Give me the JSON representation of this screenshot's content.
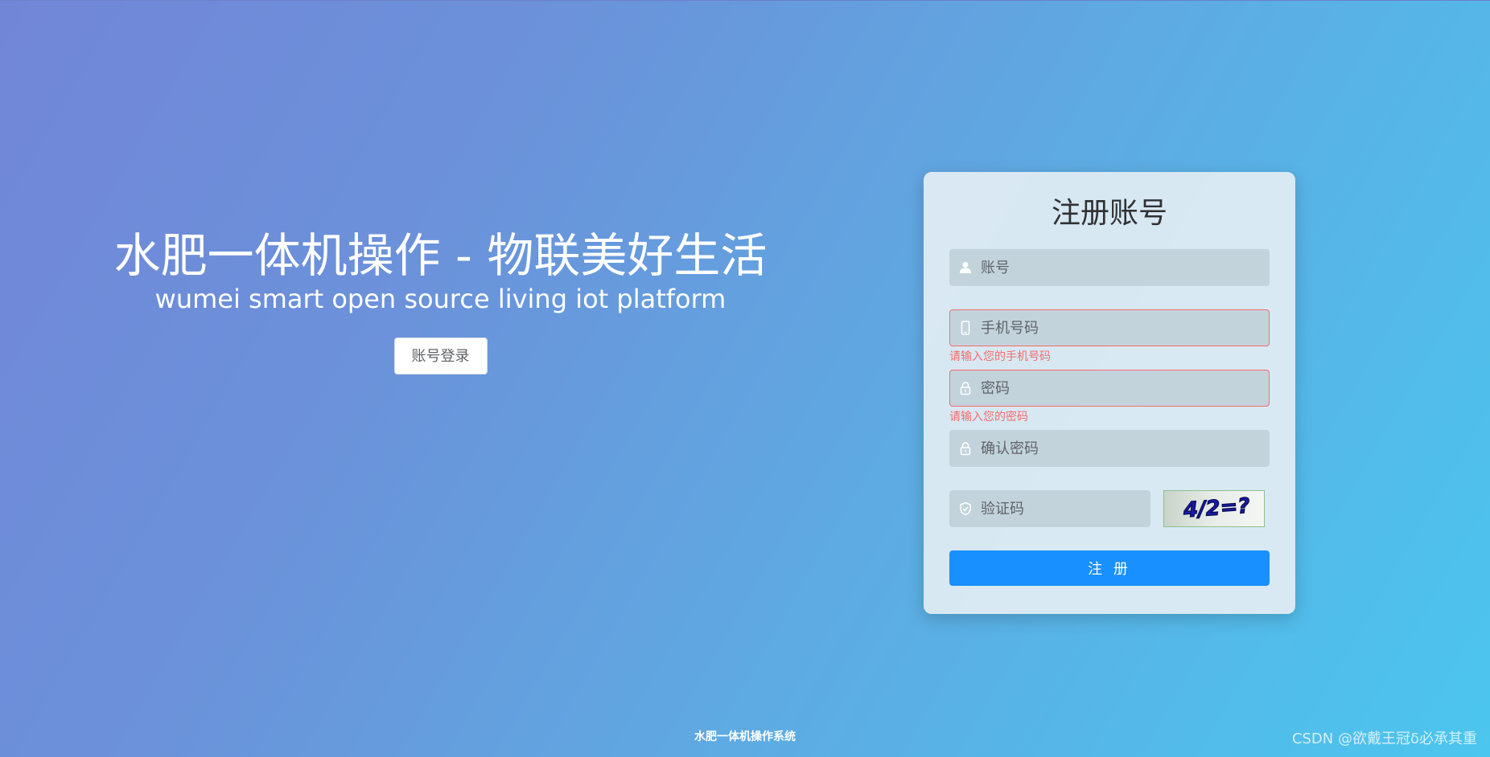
{
  "hero": {
    "title": "水肥一体机操作 - 物联美好生活",
    "subtitle": "wumei smart open source living iot platform",
    "login_button": "账号登录"
  },
  "register": {
    "title": "注册账号",
    "account_placeholder": "账号",
    "phone_placeholder": "手机号码",
    "phone_error": "请输入您的手机号码",
    "password_placeholder": "密码",
    "password_error": "请输入您的密码",
    "confirm_password_placeholder": "确认密码",
    "captcha_placeholder": "验证码",
    "captcha_text": "4/2=?",
    "submit_label": "注 册"
  },
  "footer": {
    "text": "水肥一体机操作系统"
  },
  "watermark": "CSDN @欲戴王冠δ必承其重",
  "colors": {
    "primary": "#1890ff",
    "error": "#f56c6c",
    "gradient_start": "#7286d8",
    "gradient_end": "#4bc6ee"
  },
  "icons": {
    "account": "user-icon",
    "phone": "mobile-phone-icon",
    "password": "lock-icon",
    "confirm_password": "lock-icon",
    "captcha": "shield-check-icon"
  }
}
